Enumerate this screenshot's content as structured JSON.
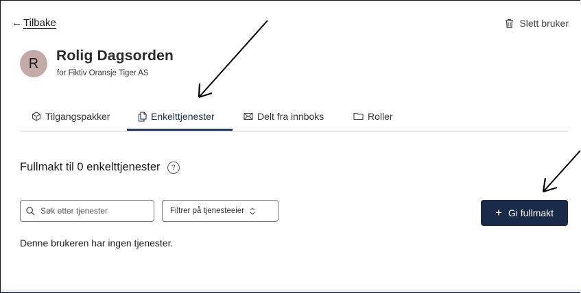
{
  "nav": {
    "back_arrow": "←",
    "back_label": "Tilbake",
    "delete_label": "Slett bruker"
  },
  "user": {
    "initial": "R",
    "name": "Rolig Dagsorden",
    "org": "for Fiktiv Oransje Tiger AS"
  },
  "tabs": [
    {
      "label": "Tilgangspakker",
      "icon": "package-icon",
      "active": false
    },
    {
      "label": "Enkelttjenester",
      "icon": "copy-icon",
      "active": true
    },
    {
      "label": "Delt fra innboks",
      "icon": "envelope-icon",
      "active": false
    },
    {
      "label": "Roller",
      "icon": "folder-icon",
      "active": false
    }
  ],
  "section": {
    "title": "Fullmakt til 0 enkelttjenester",
    "help": "?"
  },
  "search": {
    "placeholder": "Søk etter tjenester"
  },
  "filter": {
    "label": "Filtrer på tjenesteeier",
    "chevron": "⌃⌄"
  },
  "actions": {
    "give_plus": "+",
    "give_label": "Gi fullmakt"
  },
  "empty_message": "Denne brukeren har ingen tjenester.",
  "colors": {
    "primary_button": "#1a2a49",
    "avatar_bg": "#c4a9a9",
    "tab_active_underline": "#2a3a5c"
  }
}
